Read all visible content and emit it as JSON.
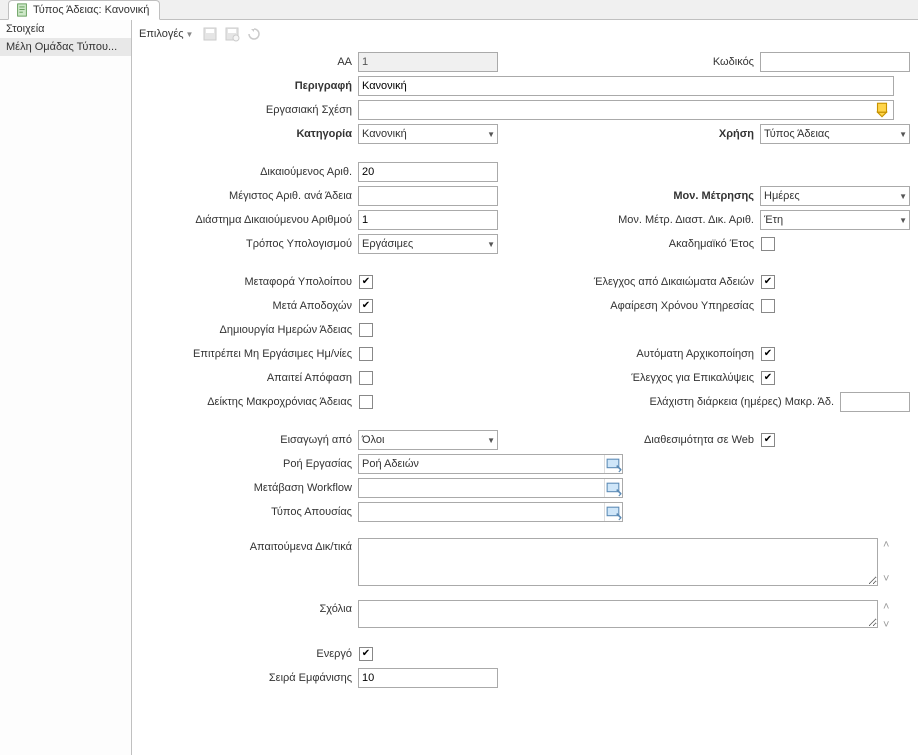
{
  "tab": {
    "title": "Τύπος Άδειας: Κανονική"
  },
  "sidebar": {
    "items": [
      {
        "label": "Στοιχεία"
      },
      {
        "label": "Μέλη Ομάδας Τύπου..."
      }
    ]
  },
  "toolbar": {
    "options": "Επιλογές"
  },
  "labels": {
    "aa": "ΑΑ",
    "code": "Κωδικός",
    "description": "Περιγραφή",
    "work_relation": "Εργασιακή Σχέση",
    "category": "Κατηγορία",
    "usage": "Χρήση",
    "entitled_num": "Δικαιούμενος Αριθ.",
    "max_per_leave": "Μέγιστος Αριθ. ανά Άδεια",
    "unit": "Μον. Μέτρησης",
    "interval_entitled": "Διάστημα Δικαιούμενου Αριθμού",
    "interval_unit": "Μον. Μέτρ. Διαστ. Δικ. Αριθ.",
    "calc_method": "Τρόπος Υπολογισμού",
    "academic_year": "Ακαδημαϊκό Έτος",
    "carry_over": "Μεταφορά Υπολοίπου",
    "rights_check": "Έλεγχος από Δικαιώματα Αδειών",
    "paid": "Μετά Αποδοχών",
    "deduct_service": "Αφαίρεση Χρόνου Υπηρεσίας",
    "create_leave_days": "Δημιουργία Ημερών Άδειας",
    "allow_nonwork": "Επιτρέπει Μη Εργάσιμες Ημ/νίες",
    "auto_init": "Αυτόματη Αρχικοποίηση",
    "requires_decision": "Απαιτεί Απόφαση",
    "overlap_check": "Έλεγχος για Επικαλύψεις",
    "long_leave_indicator": "Δείκτης Μακροχρόνιας Άδειας",
    "min_long_days": "Ελάχιστη διάρκεια (ημέρες) Μακρ. Άδ.",
    "insert_by": "Εισαγωγή από",
    "web_avail": "Διαθεσιμότητα σε Web",
    "workflow": "Ροή Εργασίας",
    "workflow_transition": "Μετάβαση Workflow",
    "absence_type": "Τύπος Απουσίας",
    "required_docs": "Απαιτούμενα Δικ/τικά",
    "comments": "Σχόλια",
    "active": "Ενεργό",
    "display_order": "Σειρά Εμφάνισης"
  },
  "values": {
    "aa": "1",
    "code": "",
    "description": "Κανονική",
    "work_relation": "",
    "category": "Κανονική",
    "usage": "Τύπος Άδειας",
    "entitled_num": "20",
    "max_per_leave": "",
    "unit": "Ημέρες",
    "interval_entitled": "1",
    "interval_unit": "Έτη",
    "calc_method": "Εργάσιμες",
    "academic_year": false,
    "carry_over": true,
    "rights_check": true,
    "paid": true,
    "deduct_service": false,
    "create_leave_days": false,
    "allow_nonwork": false,
    "auto_init": true,
    "requires_decision": false,
    "overlap_check": true,
    "long_leave_indicator": false,
    "min_long_days": "",
    "insert_by": "Όλοι",
    "web_avail": true,
    "workflow": "Ροή Αδειών",
    "workflow_transition": "",
    "absence_type": "",
    "required_docs": "",
    "comments": "",
    "active": true,
    "display_order": "10"
  }
}
